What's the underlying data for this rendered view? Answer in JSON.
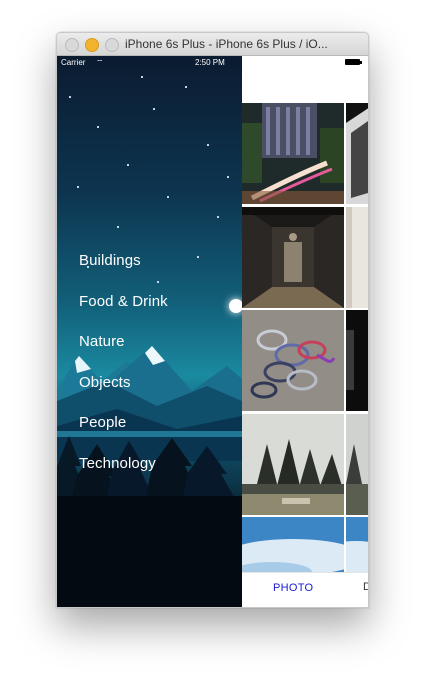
{
  "window": {
    "title": "iPhone 6s Plus - iPhone 6s Plus / iO..."
  },
  "status_bar": {
    "carrier": "Carrier",
    "time": "2:50 PM"
  },
  "menu": {
    "items": [
      {
        "label": "Buildings"
      },
      {
        "label": "Food & Drink"
      },
      {
        "label": "Nature"
      },
      {
        "label": "Objects"
      },
      {
        "label": "People"
      },
      {
        "label": "Technology"
      }
    ]
  },
  "photos": {
    "tiles": [
      {
        "subject": "city-light-trails"
      },
      {
        "subject": "dark-architecture"
      },
      {
        "subject": "dark-corridor"
      },
      {
        "subject": "pale-interior"
      },
      {
        "subject": "carabiners"
      },
      {
        "subject": "dark-still-life"
      },
      {
        "subject": "pine-trees-field"
      },
      {
        "subject": "misty-trees"
      },
      {
        "subject": "blue-sky"
      },
      {
        "subject": "blue-sky"
      }
    ]
  },
  "tab_bar": {
    "active_tab": "PHOTO",
    "next_tab_partial": "D"
  },
  "colors": {
    "traffic_close": "#d9d9d9",
    "traffic_minimize": "#f4b32e",
    "traffic_zoom": "#d9d9d9",
    "active_tab": "#1a1ad6",
    "menu_text": "#ffffff"
  }
}
